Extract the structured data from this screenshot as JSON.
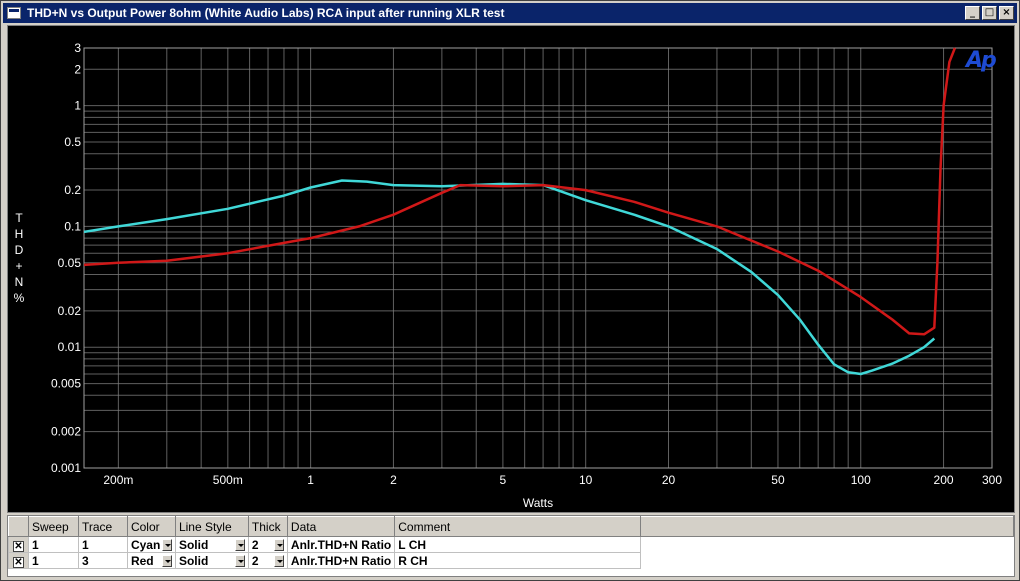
{
  "window": {
    "title": "THD+N vs Output Power 8ohm (White Audio Labs) RCA input after running XLR test",
    "buttons": {
      "minimize": "_",
      "maximize": "□",
      "close": "×"
    }
  },
  "logo": "Ap",
  "chart_data": {
    "type": "line",
    "xscale": "log",
    "yscale": "log",
    "xlim": [
      0.15,
      300
    ],
    "ylim": [
      0.001,
      3
    ],
    "xlabel": "Watts",
    "ylabel": "THD+N %",
    "ylabel_chars": [
      "T",
      "H",
      "D",
      "+",
      "N",
      "%"
    ],
    "grid": true,
    "background": "#000000",
    "grid_color": "#808080",
    "x_ticks": [
      {
        "v": 0.2,
        "label": "200m"
      },
      {
        "v": 0.5,
        "label": "500m"
      },
      {
        "v": 1,
        "label": "1"
      },
      {
        "v": 2,
        "label": "2"
      },
      {
        "v": 5,
        "label": "5"
      },
      {
        "v": 10,
        "label": "10"
      },
      {
        "v": 20,
        "label": "20"
      },
      {
        "v": 50,
        "label": "50"
      },
      {
        "v": 100,
        "label": "100"
      },
      {
        "v": 200,
        "label": "200"
      },
      {
        "v": 300,
        "label": "300"
      }
    ],
    "y_ticks": [
      {
        "v": 3,
        "label": "3"
      },
      {
        "v": 2,
        "label": "2"
      },
      {
        "v": 1,
        "label": "1"
      },
      {
        "v": 0.5,
        "label": "0.5"
      },
      {
        "v": 0.2,
        "label": "0.2"
      },
      {
        "v": 0.1,
        "label": "0.1"
      },
      {
        "v": 0.05,
        "label": "0.05"
      },
      {
        "v": 0.02,
        "label": "0.02"
      },
      {
        "v": 0.01,
        "label": "0.01"
      },
      {
        "v": 0.005,
        "label": "0.005"
      },
      {
        "v": 0.002,
        "label": "0.002"
      },
      {
        "v": 0.001,
        "label": "0.001"
      }
    ],
    "series": [
      {
        "color": "#40d8d8",
        "x": [
          0.15,
          0.2,
          0.3,
          0.5,
          0.8,
          1.0,
          1.3,
          1.6,
          2.0,
          3.0,
          5.0,
          7.0,
          10,
          15,
          20,
          30,
          40,
          50,
          60,
          70,
          80,
          90,
          100,
          110,
          130,
          150,
          170,
          185
        ],
        "y": [
          0.09,
          0.1,
          0.115,
          0.14,
          0.18,
          0.21,
          0.24,
          0.235,
          0.22,
          0.215,
          0.225,
          0.22,
          0.165,
          0.125,
          0.1,
          0.065,
          0.042,
          0.027,
          0.017,
          0.0105,
          0.0072,
          0.0062,
          0.006,
          0.0064,
          0.0073,
          0.0085,
          0.01,
          0.0118
        ]
      },
      {
        "color": "#d01818",
        "x": [
          0.15,
          0.2,
          0.3,
          0.5,
          0.8,
          1.0,
          1.5,
          2.0,
          3.0,
          3.5,
          5.0,
          7.0,
          10,
          15,
          20,
          30,
          50,
          70,
          100,
          130,
          150,
          170,
          185,
          190,
          195,
          200,
          210,
          220
        ],
        "y": [
          0.048,
          0.05,
          0.052,
          0.06,
          0.073,
          0.08,
          0.1,
          0.125,
          0.19,
          0.22,
          0.215,
          0.22,
          0.2,
          0.16,
          0.13,
          0.1,
          0.062,
          0.043,
          0.026,
          0.017,
          0.013,
          0.0128,
          0.0145,
          0.05,
          0.3,
          1.0,
          2.3,
          3.0
        ]
      }
    ]
  },
  "table": {
    "headers": [
      "Sweep",
      "Trace",
      "Color",
      "Line Style",
      "Thick",
      "Data",
      "Comment"
    ],
    "rows": [
      {
        "sweep": "1",
        "trace": "1",
        "color": "Cyan",
        "style": "Solid",
        "thick": "2",
        "data": "Anlr.THD+N Ratio",
        "comment": "L CH"
      },
      {
        "sweep": "1",
        "trace": "3",
        "color": "Red",
        "style": "Solid",
        "thick": "2",
        "data": "Anlr.THD+N Ratio",
        "comment": "R CH"
      }
    ]
  }
}
